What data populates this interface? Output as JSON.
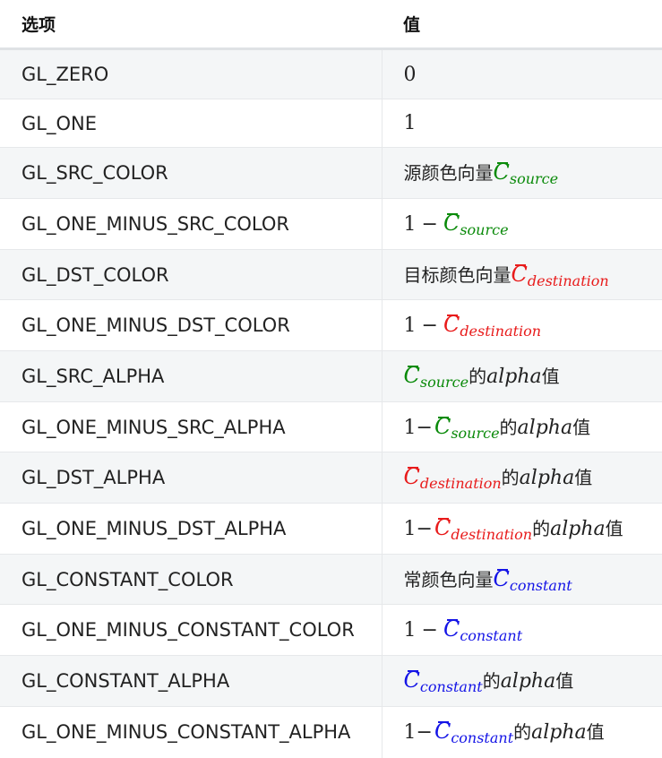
{
  "header": {
    "col1": "选项",
    "col2": "值"
  },
  "colors": {
    "source": "#0a8a0a",
    "destination": "#e81b1b",
    "constant": "#1414e6"
  },
  "rows": [
    {
      "option": "GL_ZERO",
      "value": {
        "number": "0"
      }
    },
    {
      "option": "GL_ONE",
      "value": {
        "number": "1"
      }
    },
    {
      "option": "GL_SRC_COLOR",
      "value": {
        "prefix": "源颜色向量",
        "symbol": "C",
        "sub": "source"
      }
    },
    {
      "option": "GL_ONE_MINUS_SRC_COLOR",
      "value": {
        "number": "1",
        "minus": "−",
        "symbol": "C",
        "sub": "source"
      }
    },
    {
      "option": "GL_DST_COLOR",
      "value": {
        "prefix": "目标颜色向量",
        "symbol": "C",
        "sub": "destination"
      }
    },
    {
      "option": "GL_ONE_MINUS_DST_COLOR",
      "value": {
        "number": "1",
        "minus": "−",
        "symbol": "C",
        "sub": "destination"
      }
    },
    {
      "option": "GL_SRC_ALPHA",
      "value": {
        "symbol": "C",
        "sub": "source",
        "of": "的",
        "alpha": "alpha",
        "suffix": "值"
      }
    },
    {
      "option": "GL_ONE_MINUS_SRC_ALPHA",
      "value": {
        "number": "1",
        "minus": "−",
        "symbol": "C",
        "sub": "source",
        "of": "的",
        "alpha": "alpha",
        "suffix": "值"
      }
    },
    {
      "option": "GL_DST_ALPHA",
      "value": {
        "symbol": "C",
        "sub": "destination",
        "of": "的",
        "alpha": "alpha",
        "suffix": "值"
      }
    },
    {
      "option": "GL_ONE_MINUS_DST_ALPHA",
      "value": {
        "number": "1",
        "minus": "−",
        "symbol": "C",
        "sub": "destination",
        "of": "的",
        "alpha": "alpha",
        "suffix": "值"
      }
    },
    {
      "option": "GL_CONSTANT_COLOR",
      "value": {
        "prefix": "常颜色向量",
        "symbol": "C",
        "sub": "constant"
      }
    },
    {
      "option": "GL_ONE_MINUS_CONSTANT_COLOR",
      "value": {
        "number": "1",
        "minus": "−",
        "symbol": "C",
        "sub": "constant"
      }
    },
    {
      "option": "GL_CONSTANT_ALPHA",
      "value": {
        "symbol": "C",
        "sub": "constant",
        "of": "的",
        "alpha": "alpha",
        "suffix": "值"
      }
    },
    {
      "option": "GL_ONE_MINUS_CONSTANT_ALPHA",
      "value": {
        "number": "1",
        "minus": "−",
        "symbol": "C",
        "sub": "constant",
        "of": "的",
        "alpha": "alpha",
        "suffix": "值"
      }
    }
  ]
}
